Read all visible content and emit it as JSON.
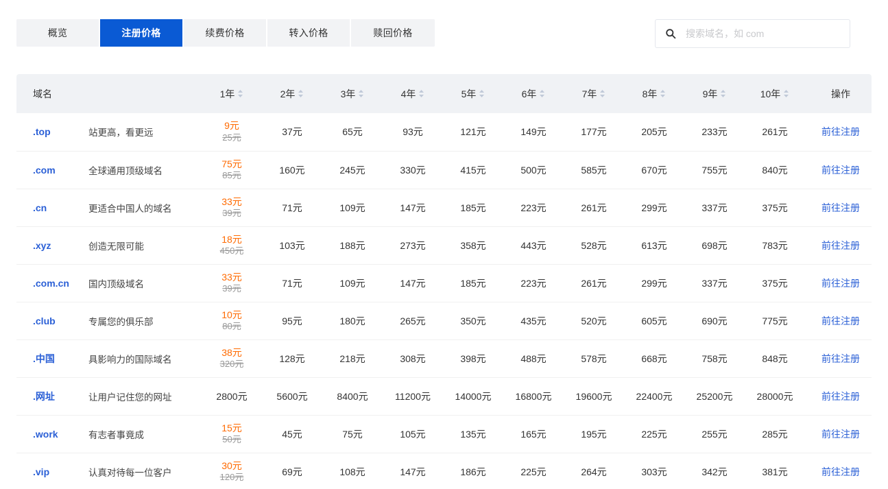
{
  "tabs": [
    {
      "label": "概览",
      "active": false
    },
    {
      "label": "注册价格",
      "active": true
    },
    {
      "label": "续费价格",
      "active": false
    },
    {
      "label": "转入价格",
      "active": false
    },
    {
      "label": "赎回价格",
      "active": false
    }
  ],
  "search": {
    "placeholder": "搜索域名，如 com",
    "value": "",
    "icon": "search-icon"
  },
  "colors": {
    "active_tab_bg": "#0a5ad4",
    "tab_bg": "#f2f3f5",
    "link": "#2a5fd6",
    "promo": "#ff6a00",
    "old_price": "#9a9a9a",
    "header_bg": "#f0f2f5"
  },
  "table": {
    "headers": {
      "name": "域名",
      "desc": "",
      "years": [
        "1年",
        "2年",
        "3年",
        "4年",
        "5年",
        "6年",
        "7年",
        "8年",
        "9年",
        "10年"
      ],
      "action": "操作"
    },
    "action_label": "前往注册",
    "rows": [
      {
        "domain": ".top",
        "desc": "站更高，看更远",
        "y1_new": "9元",
        "y1_old": "25元",
        "prices": [
          "37元",
          "65元",
          "93元",
          "121元",
          "149元",
          "177元",
          "205元",
          "233元",
          "261元"
        ]
      },
      {
        "domain": ".com",
        "desc": "全球通用顶级域名",
        "y1_new": "75元",
        "y1_old": "85元",
        "prices": [
          "160元",
          "245元",
          "330元",
          "415元",
          "500元",
          "585元",
          "670元",
          "755元",
          "840元"
        ]
      },
      {
        "domain": ".cn",
        "desc": "更适合中国人的域名",
        "y1_new": "33元",
        "y1_old": "39元",
        "prices": [
          "71元",
          "109元",
          "147元",
          "185元",
          "223元",
          "261元",
          "299元",
          "337元",
          "375元"
        ]
      },
      {
        "domain": ".xyz",
        "desc": "创造无限可能",
        "y1_new": "18元",
        "y1_old": "450元",
        "prices": [
          "103元",
          "188元",
          "273元",
          "358元",
          "443元",
          "528元",
          "613元",
          "698元",
          "783元"
        ]
      },
      {
        "domain": ".com.cn",
        "desc": "国内顶级域名",
        "y1_new": "33元",
        "y1_old": "39元",
        "prices": [
          "71元",
          "109元",
          "147元",
          "185元",
          "223元",
          "261元",
          "299元",
          "337元",
          "375元"
        ]
      },
      {
        "domain": ".club",
        "desc": "专属您的俱乐部",
        "y1_new": "10元",
        "y1_old": "80元",
        "prices": [
          "95元",
          "180元",
          "265元",
          "350元",
          "435元",
          "520元",
          "605元",
          "690元",
          "775元"
        ]
      },
      {
        "domain": ".中国",
        "desc": "具影响力的国际域名",
        "y1_new": "38元",
        "y1_old": "320元",
        "prices": [
          "128元",
          "218元",
          "308元",
          "398元",
          "488元",
          "578元",
          "668元",
          "758元",
          "848元"
        ]
      },
      {
        "domain": ".网址",
        "desc": "让用户记住您的网址",
        "y1_new": "2800元",
        "y1_old": "",
        "prices": [
          "5600元",
          "8400元",
          "11200元",
          "14000元",
          "16800元",
          "19600元",
          "22400元",
          "25200元",
          "28000元"
        ]
      },
      {
        "domain": ".work",
        "desc": "有志者事竟成",
        "y1_new": "15元",
        "y1_old": "50元",
        "prices": [
          "45元",
          "75元",
          "105元",
          "135元",
          "165元",
          "195元",
          "225元",
          "255元",
          "285元"
        ]
      },
      {
        "domain": ".vip",
        "desc": "认真对待每一位客户",
        "y1_new": "30元",
        "y1_old": "120元",
        "prices": [
          "69元",
          "108元",
          "147元",
          "186元",
          "225元",
          "264元",
          "303元",
          "342元",
          "381元"
        ]
      }
    ]
  }
}
